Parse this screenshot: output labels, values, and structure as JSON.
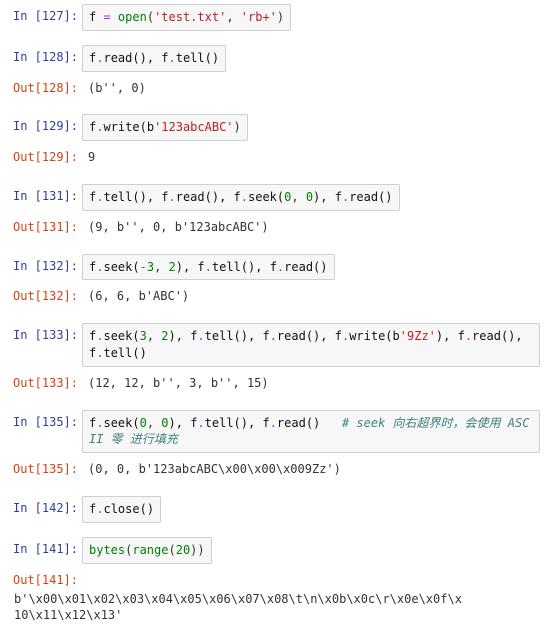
{
  "cells": [
    {
      "n": 127,
      "type": "in",
      "frags": [
        {
          "t": "f ",
          "c": "tk-name"
        },
        {
          "t": "=",
          "c": "tk-op"
        },
        {
          "t": " ",
          "c": ""
        },
        {
          "t": "open",
          "c": "tk-func"
        },
        {
          "t": "(",
          "c": ""
        },
        {
          "t": "'test.txt'",
          "c": "tk-str"
        },
        {
          "t": ", ",
          "c": ""
        },
        {
          "t": "'rb+'",
          "c": "tk-str"
        },
        {
          "t": ")",
          "c": ""
        }
      ]
    },
    {
      "n": 128,
      "type": "in",
      "frags": [
        {
          "t": "f",
          "c": "tk-name"
        },
        {
          "t": ".",
          "c": "tk-op"
        },
        {
          "t": "read(), f",
          "c": "tk-name"
        },
        {
          "t": ".",
          "c": "tk-op"
        },
        {
          "t": "tell()",
          "c": "tk-name"
        }
      ]
    },
    {
      "n": 128,
      "type": "out",
      "text": "(b'', 0)"
    },
    {
      "n": 129,
      "type": "in",
      "frags": [
        {
          "t": "f",
          "c": "tk-name"
        },
        {
          "t": ".",
          "c": "tk-op"
        },
        {
          "t": "write(",
          "c": "tk-name"
        },
        {
          "t": "b",
          "c": "tk-name"
        },
        {
          "t": "'123abcABC'",
          "c": "tk-str"
        },
        {
          "t": ")",
          "c": ""
        }
      ]
    },
    {
      "n": 129,
      "type": "out",
      "text": "9"
    },
    {
      "n": 131,
      "type": "in",
      "frags": [
        {
          "t": "f",
          "c": "tk-name"
        },
        {
          "t": ".",
          "c": "tk-op"
        },
        {
          "t": "tell(), f",
          "c": "tk-name"
        },
        {
          "t": ".",
          "c": "tk-op"
        },
        {
          "t": "read(), f",
          "c": "tk-name"
        },
        {
          "t": ".",
          "c": "tk-op"
        },
        {
          "t": "seek(",
          "c": "tk-name"
        },
        {
          "t": "0",
          "c": "tk-num"
        },
        {
          "t": ", ",
          "c": ""
        },
        {
          "t": "0",
          "c": "tk-num"
        },
        {
          "t": "), f",
          "c": "tk-name"
        },
        {
          "t": ".",
          "c": "tk-op"
        },
        {
          "t": "read()",
          "c": "tk-name"
        }
      ]
    },
    {
      "n": 131,
      "type": "out",
      "text": "(9, b'', 0, b'123abcABC')"
    },
    {
      "n": 132,
      "type": "in",
      "frags": [
        {
          "t": "f",
          "c": "tk-name"
        },
        {
          "t": ".",
          "c": "tk-op"
        },
        {
          "t": "seek(",
          "c": "tk-name"
        },
        {
          "t": "-",
          "c": "tk-op"
        },
        {
          "t": "3",
          "c": "tk-num"
        },
        {
          "t": ", ",
          "c": ""
        },
        {
          "t": "2",
          "c": "tk-num"
        },
        {
          "t": "), f",
          "c": "tk-name"
        },
        {
          "t": ".",
          "c": "tk-op"
        },
        {
          "t": "tell(), f",
          "c": "tk-name"
        },
        {
          "t": ".",
          "c": "tk-op"
        },
        {
          "t": "read()",
          "c": "tk-name"
        }
      ]
    },
    {
      "n": 132,
      "type": "out",
      "text": "(6, 6, b'ABC')"
    },
    {
      "n": 133,
      "type": "in",
      "frags": [
        {
          "t": "f",
          "c": "tk-name"
        },
        {
          "t": ".",
          "c": "tk-op"
        },
        {
          "t": "seek(",
          "c": "tk-name"
        },
        {
          "t": "3",
          "c": "tk-num"
        },
        {
          "t": ", ",
          "c": ""
        },
        {
          "t": "2",
          "c": "tk-num"
        },
        {
          "t": "), f",
          "c": "tk-name"
        },
        {
          "t": ".",
          "c": "tk-op"
        },
        {
          "t": "tell(), f",
          "c": "tk-name"
        },
        {
          "t": ".",
          "c": "tk-op"
        },
        {
          "t": "read(), f",
          "c": "tk-name"
        },
        {
          "t": ".",
          "c": "tk-op"
        },
        {
          "t": "write(",
          "c": "tk-name"
        },
        {
          "t": "b",
          "c": "tk-name"
        },
        {
          "t": "'9Zz'",
          "c": "tk-str"
        },
        {
          "t": "), f",
          "c": "tk-name"
        },
        {
          "t": ".",
          "c": "tk-op"
        },
        {
          "t": "read(), f",
          "c": "tk-name"
        },
        {
          "t": ".",
          "c": "tk-op"
        },
        {
          "t": "tell()",
          "c": "tk-name"
        }
      ]
    },
    {
      "n": 133,
      "type": "out",
      "text": "(12, 12, b'', 3, b'', 15)"
    },
    {
      "n": 135,
      "type": "in",
      "frags": [
        {
          "t": "f",
          "c": "tk-name"
        },
        {
          "t": ".",
          "c": "tk-op"
        },
        {
          "t": "seek(",
          "c": "tk-name"
        },
        {
          "t": "0",
          "c": "tk-num"
        },
        {
          "t": ", ",
          "c": ""
        },
        {
          "t": "0",
          "c": "tk-num"
        },
        {
          "t": "), f",
          "c": "tk-name"
        },
        {
          "t": ".",
          "c": "tk-op"
        },
        {
          "t": "tell(), f",
          "c": "tk-name"
        },
        {
          "t": ".",
          "c": "tk-op"
        },
        {
          "t": "read()   ",
          "c": "tk-name"
        },
        {
          "t": "# seek 向右超界时，会使用 ASCII 零 进行填充",
          "c": "tk-comm"
        }
      ]
    },
    {
      "n": 135,
      "type": "out",
      "text": "(0, 0, b'123abcABC\\x00\\x00\\x009Zz')"
    },
    {
      "n": 142,
      "type": "in",
      "frags": [
        {
          "t": "f",
          "c": "tk-name"
        },
        {
          "t": ".",
          "c": "tk-op"
        },
        {
          "t": "close()",
          "c": "tk-name"
        }
      ]
    },
    {
      "n": 141,
      "type": "in",
      "frags": [
        {
          "t": "bytes",
          "c": "tk-func"
        },
        {
          "t": "(",
          "c": ""
        },
        {
          "t": "range",
          "c": "tk-func"
        },
        {
          "t": "(",
          "c": ""
        },
        {
          "t": "20",
          "c": "tk-num"
        },
        {
          "t": "))",
          "c": ""
        }
      ]
    },
    {
      "n": 141,
      "type": "out",
      "text": "b'\\x00\\x01\\x02\\x03\\x04\\x05\\x06\\x07\\x08\\t\\n\\x0b\\x0c\\r\\x0e\\x0f\\x10\\x11\\x12\\x13'"
    }
  ],
  "labels": {
    "in": "In ",
    "out": "Out"
  }
}
